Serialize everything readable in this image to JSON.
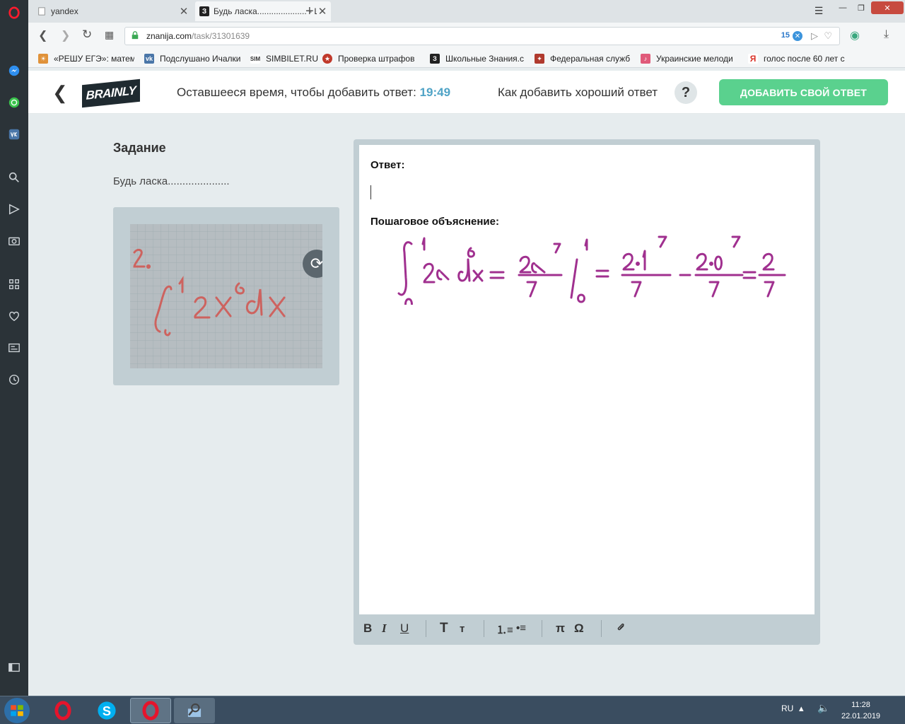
{
  "browser": {
    "tabs": [
      {
        "title": "yandex",
        "favicon": "doc-icon",
        "active": false
      },
      {
        "title": "Будь ласка..................... - Ш",
        "favicon": "znanija-icon",
        "active": true
      }
    ],
    "url": {
      "domain": "znanija.com",
      "path": "/task/31301639",
      "badge_count": "15"
    },
    "bookmarks": [
      {
        "label": "«РЕШУ ЕГЭ»: матема",
        "color": "#e0923a",
        "icon": "sun-icon"
      },
      {
        "label": "Подслушано Ичалки",
        "color": "#4a76a8",
        "icon": "vk-icon"
      },
      {
        "label": "SIMBILET.RU",
        "color": "#555555",
        "icon": "sim-icon"
      },
      {
        "label": "Проверка штрафов",
        "color": "#c0392b",
        "icon": "emblem-icon"
      },
      {
        "label": "Школьные Знания.с",
        "color": "#222222",
        "icon": "znanija-icon"
      },
      {
        "label": "Федеральная служб",
        "color": "#b03a2e",
        "icon": "emblem-icon"
      },
      {
        "label": "Украинские мелоди",
        "color": "#e05a7a",
        "icon": "melody-icon"
      },
      {
        "label": "голос после 60 лет с",
        "color": "#d93025",
        "icon": "yandex-icon"
      }
    ]
  },
  "header": {
    "logo_text": "BRAINLY",
    "timer_label": "Оставшееся время, чтобы добавить ответ:",
    "timer_value": "19:49",
    "how_label": "Как добавить хороший ответ",
    "help_symbol": "?",
    "add_button": "ДОБАВИТЬ СВОЙ ОТВЕТ"
  },
  "task": {
    "heading": "Задание",
    "text": "Будь ласка....................."
  },
  "editor": {
    "answer_label": "Ответ:",
    "explanation_label": "Пошаговое объяснение:",
    "toolbar": [
      "B",
      "I",
      "U",
      "T",
      "т",
      "π",
      "Ω"
    ]
  },
  "taskbar": {
    "lang": "RU",
    "time": "11:28",
    "date": "22.01.2019"
  },
  "colors": {
    "accent_green": "#5ad18e",
    "timer_blue": "#4fa3c6",
    "handwriting": "#a0308f"
  }
}
